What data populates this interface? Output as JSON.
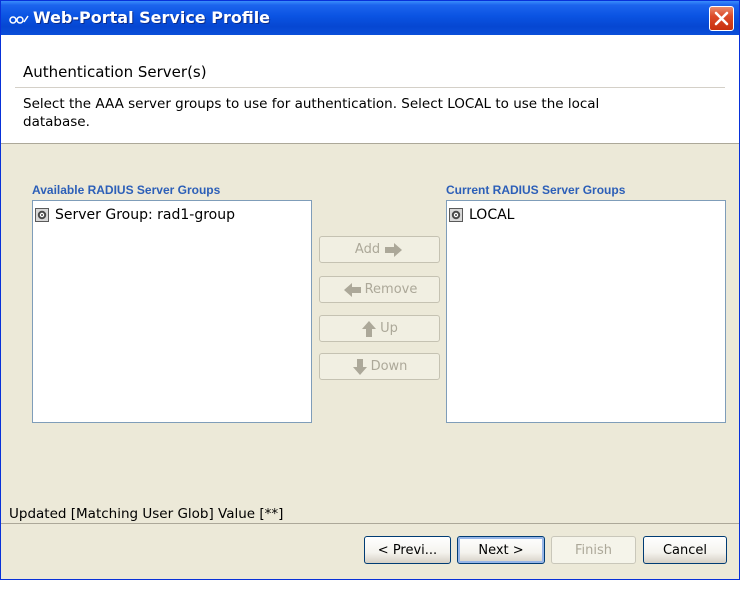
{
  "window": {
    "title": "Web-Portal Service Profile",
    "icons": {
      "app": "service-profile-icon",
      "close": "close-icon"
    }
  },
  "header": {
    "section_title": "Authentication Server(s)",
    "instructions": "Select the AAA server groups to use for authentication. Select LOCAL to use the local database."
  },
  "available": {
    "label": "Available RADIUS Server Groups",
    "items": [
      {
        "label": "Server Group: rad1-group",
        "icon": "server-group-icon"
      }
    ]
  },
  "current": {
    "label": "Current RADIUS Server Groups",
    "items": [
      {
        "label": "LOCAL",
        "icon": "server-group-icon"
      }
    ]
  },
  "buttons": {
    "add": {
      "label": "Add",
      "icon": "arrow-right-icon",
      "enabled": false
    },
    "remove": {
      "label": "Remove",
      "icon": "arrow-left-icon",
      "enabled": false
    },
    "up": {
      "label": "Up",
      "icon": "arrow-up-icon",
      "enabled": false
    },
    "down": {
      "label": "Down",
      "icon": "arrow-down-icon",
      "enabled": false
    }
  },
  "status": {
    "text": "Updated [Matching User Glob] Value [**]"
  },
  "footer": {
    "prev": {
      "label": "< Previ...",
      "enabled": true
    },
    "next": {
      "label": "Next >",
      "enabled": true
    },
    "finish": {
      "label": "Finish",
      "enabled": false
    },
    "cancel": {
      "label": "Cancel",
      "enabled": true
    }
  },
  "colors": {
    "titlebar": "#0a53e2",
    "dialog_bg": "#ece9d8",
    "list_label": "#2c5fb8",
    "disabled_text": "#aca899",
    "close_button": "#dc4a28"
  }
}
